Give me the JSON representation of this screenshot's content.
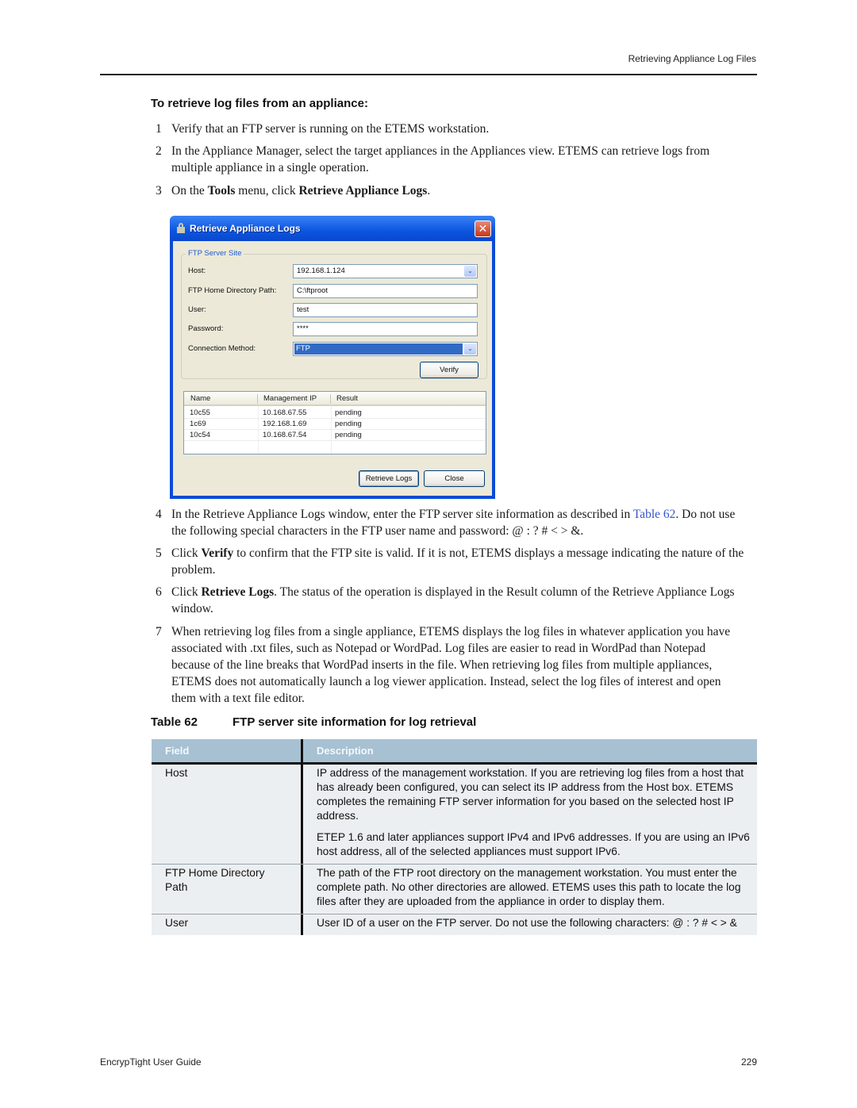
{
  "header": {
    "running_title": "Retrieving Appliance Log Files"
  },
  "procedure": {
    "title": "To retrieve log files from an appliance:",
    "steps": [
      {
        "num": "1",
        "text": "Verify that an FTP server is running on the ETEMS workstation."
      },
      {
        "num": "2",
        "text": "In the Appliance Manager, select the target appliances in the Appliances view. ETEMS can retrieve logs from multiple appliance in a single operation."
      },
      {
        "num": "3",
        "pre": "On the ",
        "b1": "Tools",
        "mid": " menu, click ",
        "b2": "Retrieve Appliance Logs",
        "post": "."
      },
      {
        "num": "4",
        "pre": "In the Retrieve Appliance Logs window, enter the FTP server site information as described in ",
        "link": "Table 62",
        "post": ". Do not use the following special characters in the FTP user name and password: @ : ? # < > &."
      },
      {
        "num": "5",
        "pre": "Click ",
        "b1": "Verify",
        "post": " to confirm that the FTP site is valid. If it is not, ETEMS displays a message indicating the nature of the problem."
      },
      {
        "num": "6",
        "pre": "Click ",
        "b1": "Retrieve Logs",
        "post": ". The status of the operation is displayed in the Result column of the Retrieve Appliance Logs window."
      },
      {
        "num": "7",
        "text": "When retrieving log files from a single appliance, ETEMS displays the log files in whatever application you have associated with .txt files, such as Notepad or WordPad. Log files are easier to read in WordPad than Notepad because of the line breaks that WordPad inserts in the file. When retrieving log files from multiple appliances, ETEMS does not automatically launch a log viewer application. Instead, select the log files of interest and open them with a text file editor."
      }
    ]
  },
  "dialog": {
    "title": "Retrieve Appliance Logs",
    "close_glyph": "✕",
    "group_label": "FTP Server Site",
    "fields": {
      "host": {
        "label": "Host:",
        "value": "192.168.1.124"
      },
      "home_dir": {
        "label": "FTP Home Directory Path:",
        "value": "C:\\ftproot"
      },
      "user": {
        "label": "User:",
        "value": "test"
      },
      "password": {
        "label": "Password:",
        "value": "****"
      },
      "connection": {
        "label": "Connection Method:",
        "value": "FTP"
      }
    },
    "dropdown_glyph": "⌄",
    "verify_label": "Verify",
    "list": {
      "columns": [
        "Name",
        "Management IP",
        "Result"
      ],
      "rows": [
        [
          "10c55",
          "10.168.67.55",
          "pending"
        ],
        [
          "1c69",
          "192.168.1.69",
          "pending"
        ],
        [
          "10c54",
          "10.168.67.54",
          "pending"
        ]
      ]
    },
    "retrieve_label": "Retrieve Logs",
    "close_label": "Close"
  },
  "table": {
    "caption_num": "Table 62",
    "caption_title": "FTP server site information for log retrieval",
    "header_color": "#a7c1d3",
    "columns": [
      "Field",
      "Description"
    ],
    "rows": [
      {
        "field": "Host",
        "desc": [
          "IP address of the management workstation. If you are retrieving log files from a host that has already been configured, you can select its IP address from the Host box. ETEMS completes the remaining FTP server information for you based on the selected host IP address.",
          "ETEP 1.6 and later appliances support IPv4 and IPv6 addresses. If you are using an IPv6 host address, all of the selected appliances must support IPv6."
        ]
      },
      {
        "field": "FTP Home Directory Path",
        "desc": [
          "The path of the FTP root directory on the management workstation. You must enter the complete path. No other directories are allowed. ETEMS uses this path to locate the log files after they are uploaded from the appliance in order to display them."
        ]
      },
      {
        "field": "User",
        "desc": [
          "User ID of a user on the FTP server. Do not use the following characters: @ : ? # < > &"
        ]
      }
    ]
  },
  "footer": {
    "guide_title": "EncrypTight User Guide",
    "page_number": "229"
  }
}
